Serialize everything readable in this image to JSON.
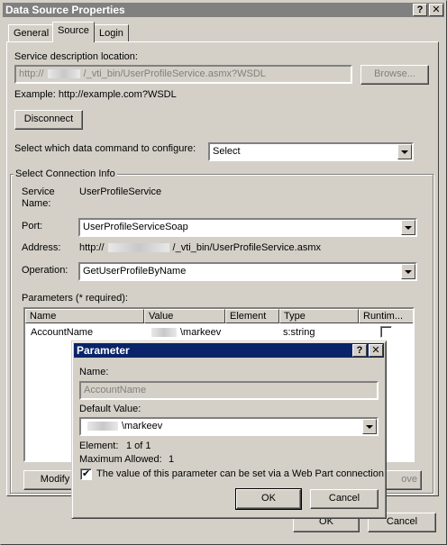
{
  "window": {
    "title": "Data Source Properties",
    "help_label": "?",
    "close_label": "✕"
  },
  "tabs": [
    {
      "label": "General"
    },
    {
      "label": "Source"
    },
    {
      "label": "Login"
    }
  ],
  "source": {
    "service_desc_label": "Service description location:",
    "service_url_prefix": "http://",
    "service_url_suffix": "/_vti_bin/UserProfileService.asmx?WSDL",
    "browse_label": "Browse...",
    "example_text": "Example: http://example.com?WSDL",
    "disconnect_label": "Disconnect",
    "command_label": "Select which data command to configure:",
    "command_value": "Select"
  },
  "connection": {
    "group_label": "Select Connection Info",
    "service_name_label_1": "Service",
    "service_name_label_2": "Name:",
    "service_name_value": "UserProfileService",
    "port_label": "Port:",
    "port_value": "UserProfileServiceSoap",
    "address_label": "Address:",
    "address_prefix": "http://",
    "address_suffix": "/_vti_bin/UserProfileService.asmx",
    "operation_label": "Operation:",
    "operation_value": "GetUserProfileByName",
    "params_label": "Parameters (* required):",
    "columns": [
      "Name",
      "Value",
      "Element",
      "Type",
      "Runtim..."
    ],
    "rows": [
      {
        "name": "AccountName",
        "value_suffix": "\\markeev",
        "element": "",
        "type": "s:string"
      }
    ],
    "modify_label": "Modify",
    "remove_label": "ove"
  },
  "footer": {
    "ok_label": "OK",
    "cancel_label": "Cancel"
  },
  "param_dialog": {
    "title": "Parameter",
    "help_label": "?",
    "close_label": "✕",
    "name_label": "Name:",
    "name_value": "AccountName",
    "default_label": "Default Value:",
    "default_value_suffix": "\\markeev",
    "element_label": "Element:",
    "element_value": "1 of 1",
    "max_allowed_label": "Maximum Allowed:",
    "max_allowed_value": "1",
    "webpart_label": "The value of this parameter can be set via a Web Part connection",
    "ok_label": "OK",
    "cancel_label": "Cancel"
  }
}
